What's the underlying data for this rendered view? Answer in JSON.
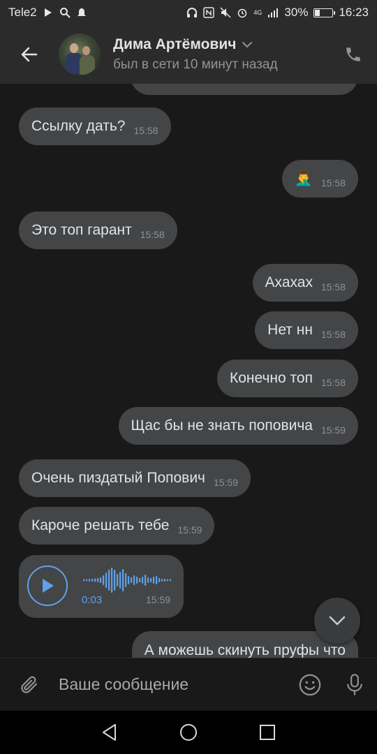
{
  "status_bar": {
    "carrier": "Tele2",
    "network": "4G",
    "battery_percent": "30%",
    "battery_level": 0.3,
    "time": "16:23",
    "left_icons": [
      "play-icon",
      "search-icon",
      "notification-icon"
    ],
    "right_icons": [
      "headphones-icon",
      "nfc-icon",
      "mute-icon",
      "alarm-icon",
      "signal-icon",
      "battery-icon"
    ]
  },
  "header": {
    "contact_name": "Дима Артёмович",
    "last_seen": "был в сети 10 минут назад",
    "icons": [
      "back-arrow-icon",
      "chevron-down-icon",
      "phone-icon"
    ]
  },
  "messages": [
    {
      "direction": "in",
      "text": "Ссылку дать?",
      "time": "15:58"
    },
    {
      "direction": "out",
      "text": "🤦‍♂️",
      "time": "15:58"
    },
    {
      "direction": "in",
      "text": "Это топ гарант",
      "time": "15:58"
    },
    {
      "direction": "out",
      "text": "Ахахах",
      "time": "15:58"
    },
    {
      "direction": "out",
      "text": "Нет нн",
      "time": "15:58"
    },
    {
      "direction": "out",
      "text": "Конечно топ",
      "time": "15:58"
    },
    {
      "direction": "out",
      "text": "Щас бы не знать поповича",
      "time": "15:59"
    },
    {
      "direction": "in",
      "text": "Очень пиздатый Попович",
      "time": "15:59"
    },
    {
      "direction": "in",
      "text": "Кароче решать тебе",
      "time": "15:59"
    },
    {
      "direction": "out",
      "text": "А можешь скинуть пруфы что",
      "time": ""
    }
  ],
  "voice_message": {
    "duration": "0:03",
    "time": "15:59"
  },
  "composer": {
    "placeholder": "Ваше сообщение",
    "icons": [
      "attach-icon",
      "emoji-icon",
      "microphone-icon"
    ]
  },
  "colors": {
    "background": "#191919",
    "bubble": "#444547",
    "accent": "#5da2ea",
    "header": "#2b2b2c"
  }
}
